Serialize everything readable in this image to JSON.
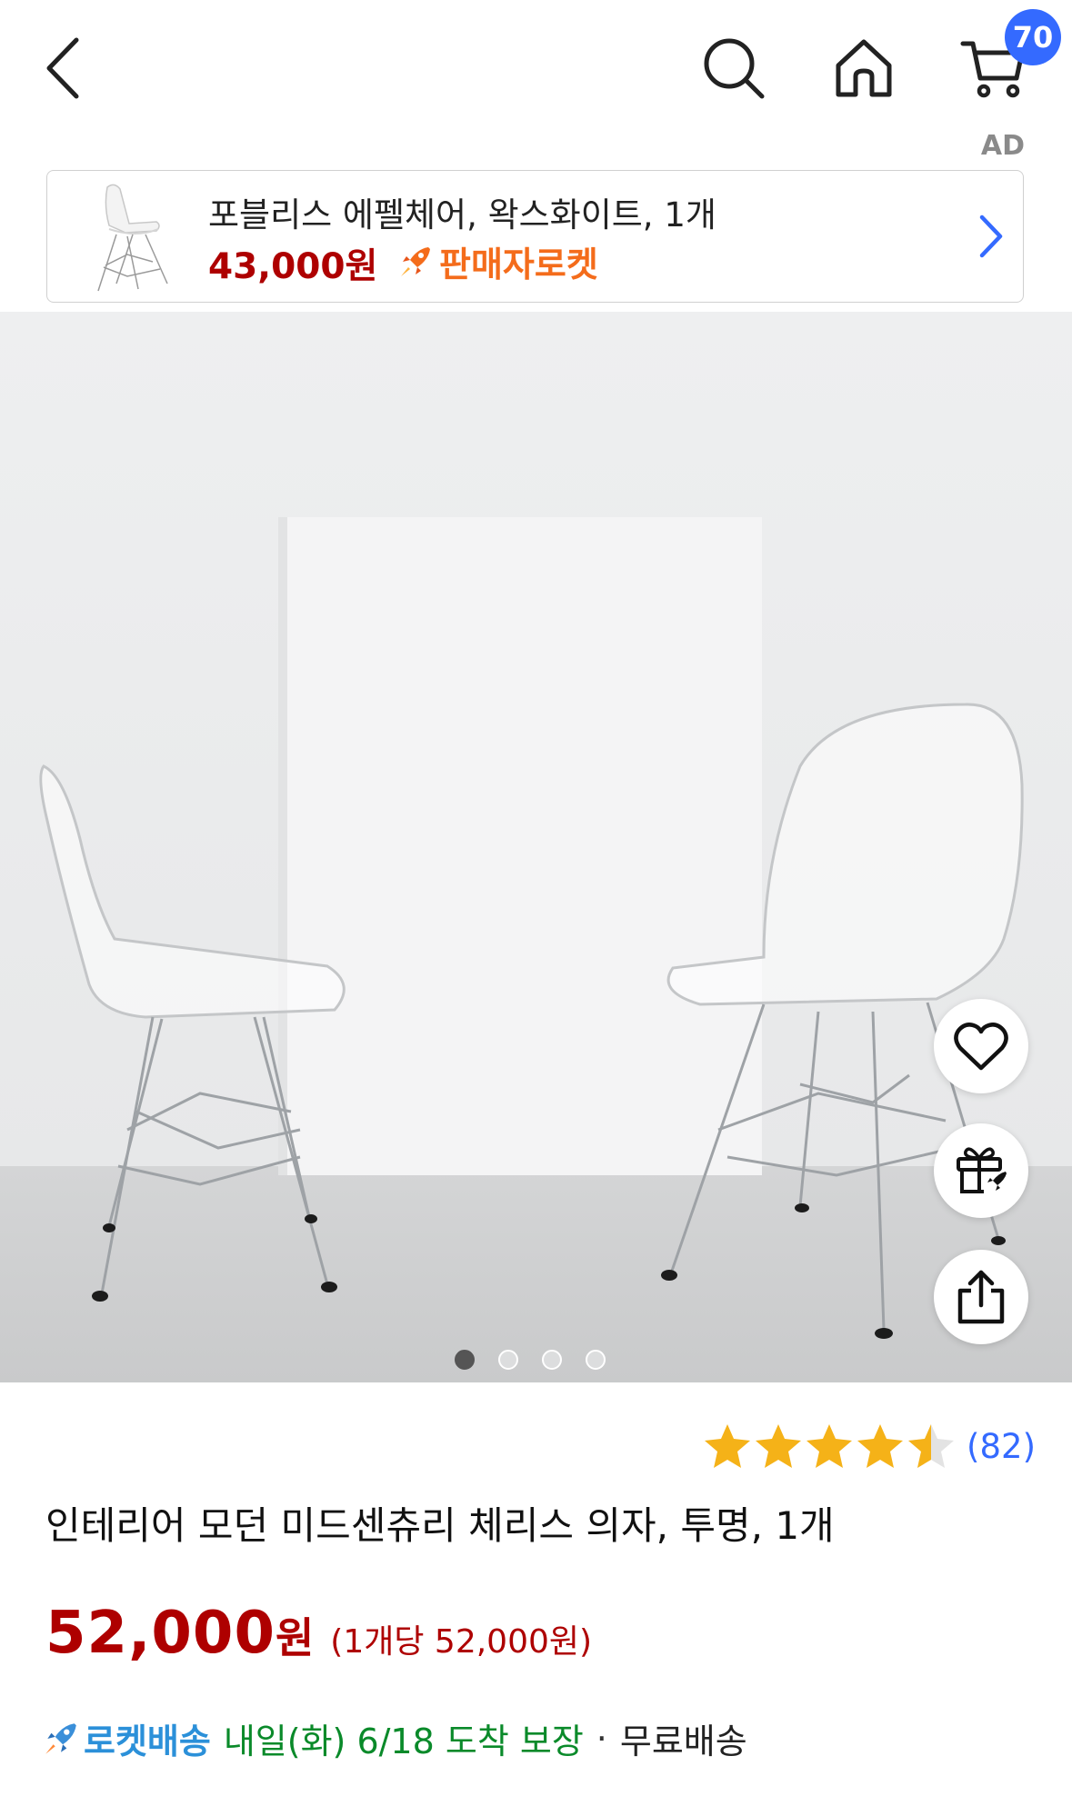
{
  "header": {
    "back_icon": "chevron-left-icon",
    "search_icon": "search-icon",
    "home_icon": "home-icon",
    "cart_icon": "cart-icon",
    "cart_count": "70"
  },
  "ad": {
    "label": "AD",
    "title": "포블리스 에펠체어, 왁스화이트, 1개",
    "price": "43,000원",
    "badge": "판매자로켓",
    "badge_color": "#f46c1b"
  },
  "gallery": {
    "total_images": 4,
    "current_index": 1
  },
  "side_actions": {
    "wishlist_icon": "heart-icon",
    "gift_icon": "gift-icon",
    "share_icon": "share-icon"
  },
  "product": {
    "rating": 4.5,
    "review_count": "(82)",
    "name": "인테리어 모던 미드센츄리 체리스 의자, 투명, 1개",
    "price_number": "52,000",
    "price_unit": "원",
    "unit_price": "(1개당 52,000원)",
    "price_color": "#ae0000"
  },
  "delivery": {
    "rocket_label": "로켓배송",
    "arrival": "내일(화) 6/18 도착 보장",
    "separator": "·",
    "shipping": "무료배송"
  }
}
